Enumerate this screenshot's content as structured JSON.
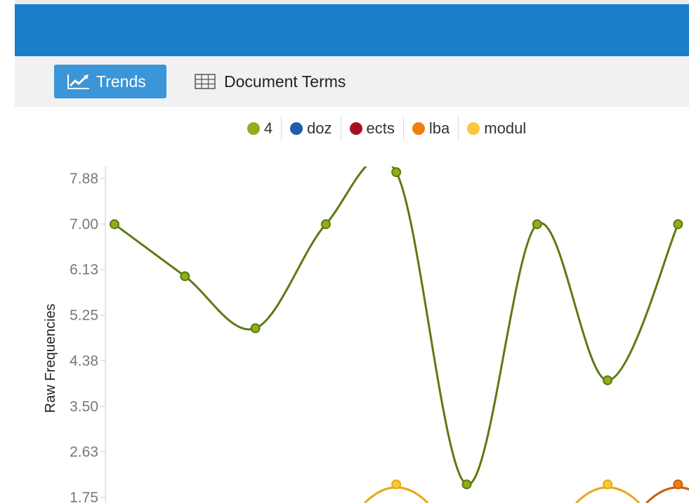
{
  "tabs": [
    {
      "label": "Trends",
      "icon": "line-chart-icon",
      "active": true
    },
    {
      "label": "Document Terms",
      "icon": "table-grid-icon",
      "active": false
    }
  ],
  "colors": {
    "header": "#1a7ecb",
    "active_tab": "#3b95d9",
    "tab_strip": "#f1f1f1"
  },
  "chart_data": {
    "type": "line",
    "ylabel": "Raw Frequencies",
    "yticks": [
      "7.88",
      "7.00",
      "6.13",
      "5.25",
      "4.38",
      "3.50",
      "2.63",
      "1.75"
    ],
    "ylim": [
      1.75,
      7.88
    ],
    "x": [
      0,
      1,
      2,
      3,
      4,
      5,
      6,
      7,
      8
    ],
    "legend_position": "top-center",
    "series": [
      {
        "name": "4",
        "color": "#8fae1b",
        "values": [
          7,
          6,
          5,
          7,
          8,
          2,
          7,
          4,
          7
        ]
      },
      {
        "name": "doz",
        "color": "#1f5ea8",
        "values": []
      },
      {
        "name": "ects",
        "color": "#a5121b",
        "values": []
      },
      {
        "name": "lba",
        "color": "#f07f0e",
        "values": [
          null,
          null,
          null,
          null,
          null,
          null,
          null,
          null,
          2
        ]
      },
      {
        "name": "modul",
        "color": "#f8c93a",
        "values": [
          null,
          null,
          null,
          null,
          2,
          null,
          null,
          2,
          null
        ]
      }
    ]
  }
}
